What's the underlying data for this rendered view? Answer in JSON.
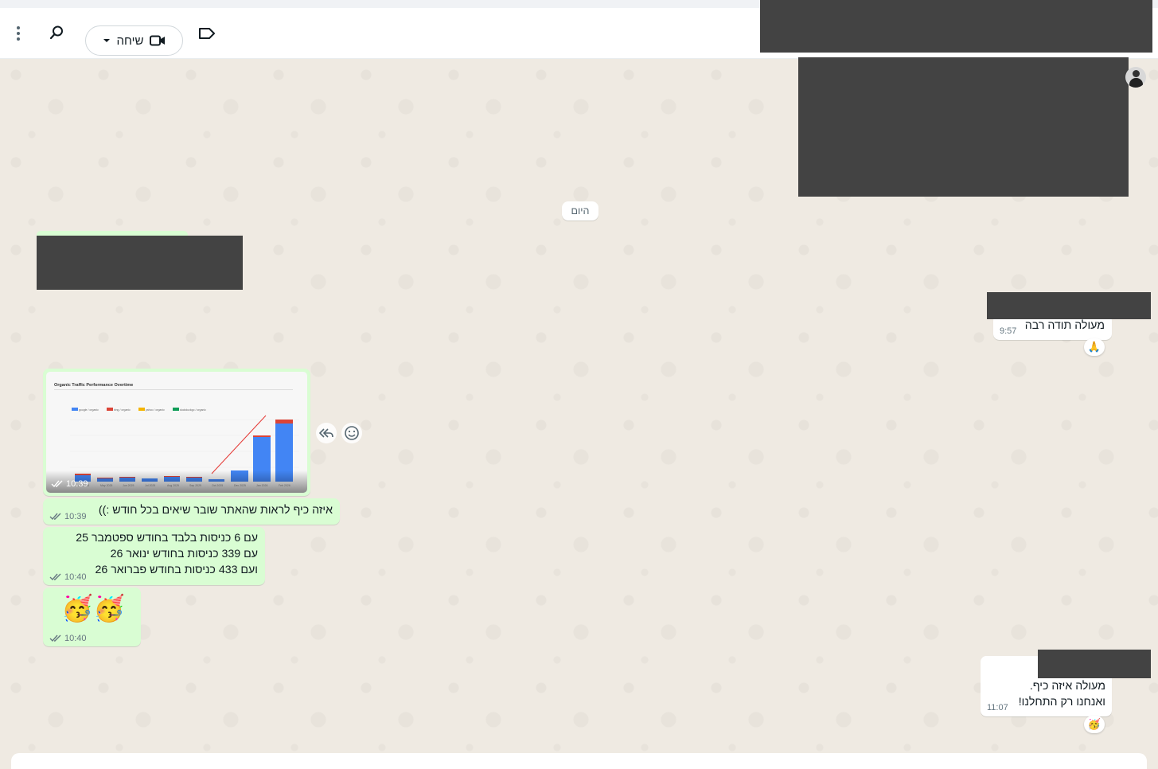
{
  "header": {
    "call_label": "שיחה"
  },
  "conversation": {
    "date_divider": "היום",
    "messages": [
      {
        "id": "in-1",
        "text": "מעולה תודה רבה",
        "time": "9:57",
        "reaction": "🙏"
      },
      {
        "id": "out-image",
        "time": "10:39",
        "image_title": "Organic Traffic Performance Overtime",
        "legend": [
          "google / organic",
          "bing / organic",
          "yahoo / organic",
          "duckduckgo / organic"
        ],
        "months": [
          "Apr 2025",
          "May 2025",
          "Jun 2025",
          "Jul 2025",
          "Aug 2025",
          "Sep 2025",
          "Oct 2025",
          "Dec 2025",
          "Jan 2026",
          "Feb 2026"
        ]
      },
      {
        "id": "out-2",
        "text": "איזה כיף לראות שהאתר שובר שיאים בכל חודש :))",
        "time": "10:39"
      },
      {
        "id": "out-3",
        "lines": [
          "עם 6 כניסות בלבד בחודש ספטמבר 25",
          "עם 339 כניסות בחודש ינואר 26",
          "ועם 433 כניסות בחודש פברואר 26"
        ],
        "time": "10:40"
      },
      {
        "id": "out-4",
        "emoji": "🥳🥳",
        "time": "10:40"
      },
      {
        "id": "in-2",
        "lines": [
          "מעולה איזה כיף.",
          "ואנחנו רק התחלנו!"
        ],
        "time": "11:07",
        "reaction": "🥳"
      }
    ]
  },
  "colors": {
    "outgoing_bubble": "#d9fdd3",
    "incoming_bubble": "#ffffff",
    "chat_background": "#efeae2",
    "redaction": "#434343"
  }
}
